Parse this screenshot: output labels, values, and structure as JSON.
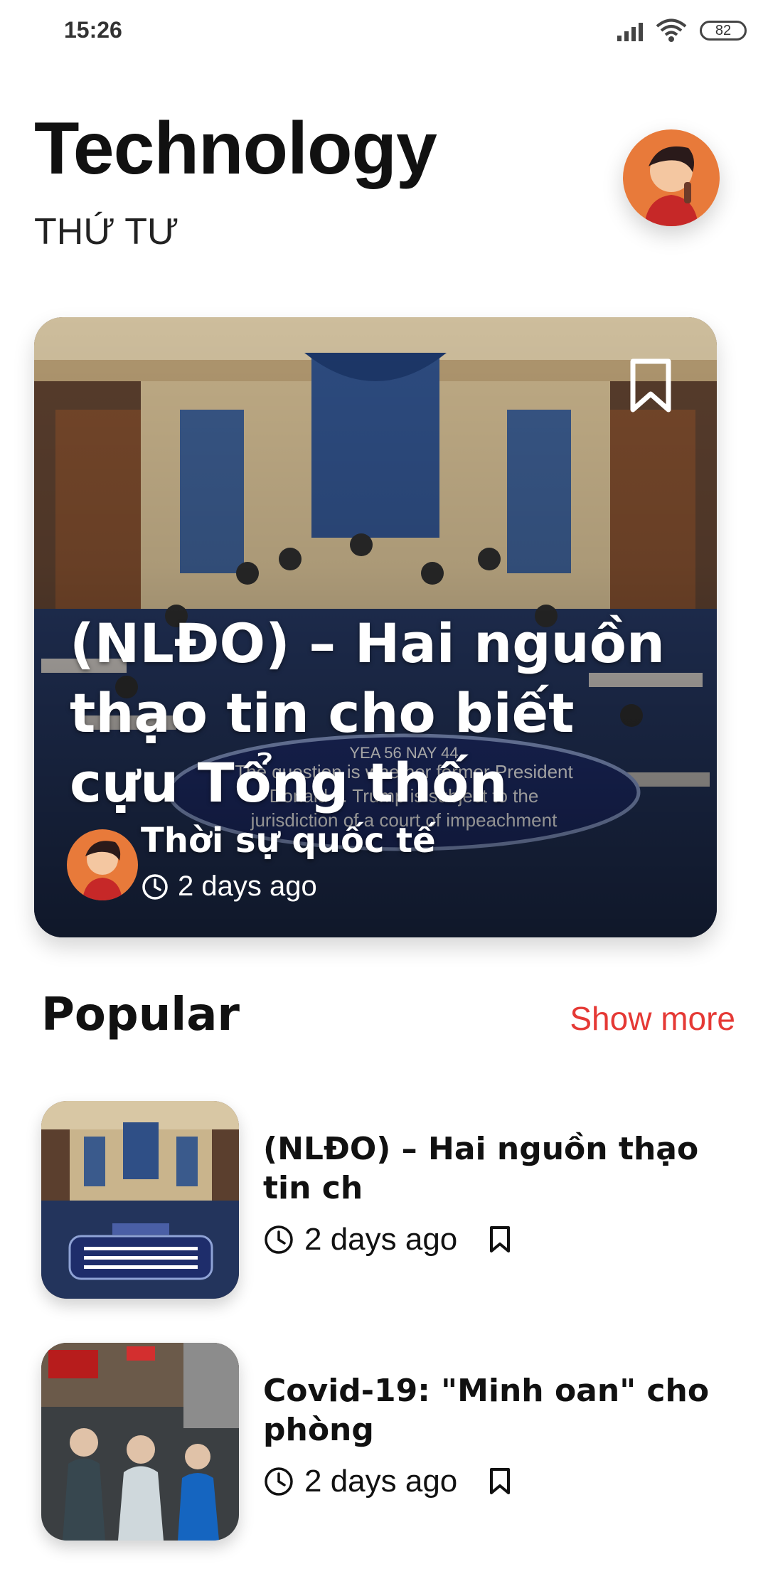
{
  "status_bar": {
    "time": "15:26",
    "battery": "82"
  },
  "header": {
    "title": "Technology",
    "subtitle": "THỨ TƯ"
  },
  "featured": {
    "title": "(NLĐO) – Hai nguồn thạo tin cho biết cựu Tổng thốn",
    "source": "Thời sự quốc tế",
    "time": "2 days ago",
    "overlay_text": "The question is whether former President Donald J. Trump is subject to the jurisdiction of a court of impeachment for acts committed while President",
    "overlay_badge": "YEA 56  NAY 44"
  },
  "popular": {
    "title": "Popular",
    "show_more": "Show more",
    "items": [
      {
        "title": "(NLĐO) – Hai nguồn thạo tin ch",
        "time": "2 days ago"
      },
      {
        "title": "Covid-19: \"Minh oan\" cho phòng",
        "time": "2 days ago"
      }
    ]
  },
  "colors": {
    "accent": "#e53935",
    "text": "#111111",
    "background": "#ffffff"
  },
  "icons": [
    "wifi-icon",
    "signal-icon",
    "battery-icon",
    "bookmark-icon",
    "clock-icon"
  ]
}
